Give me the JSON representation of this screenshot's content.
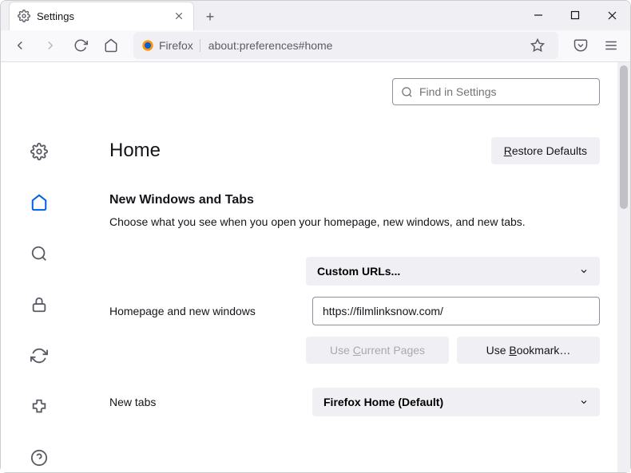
{
  "window": {
    "tab_title": "Settings",
    "url_identity": "Firefox",
    "url": "about:preferences#home"
  },
  "search": {
    "placeholder": "Find in Settings"
  },
  "header": {
    "title": "Home",
    "restore_btn": "Restore Defaults"
  },
  "section": {
    "heading": "New Windows and Tabs",
    "description": "Choose what you see when you open your homepage, new windows, and new tabs."
  },
  "homepage": {
    "dropdown_label": "Custom URLs...",
    "row_label": "Homepage and new windows",
    "url_value": "https://filmlinksnow.com/",
    "use_current": "Use Current Pages",
    "use_bookmark": "Use Bookmark…"
  },
  "newtabs": {
    "row_label": "New tabs",
    "dropdown_label": "Firefox Home (Default)"
  }
}
